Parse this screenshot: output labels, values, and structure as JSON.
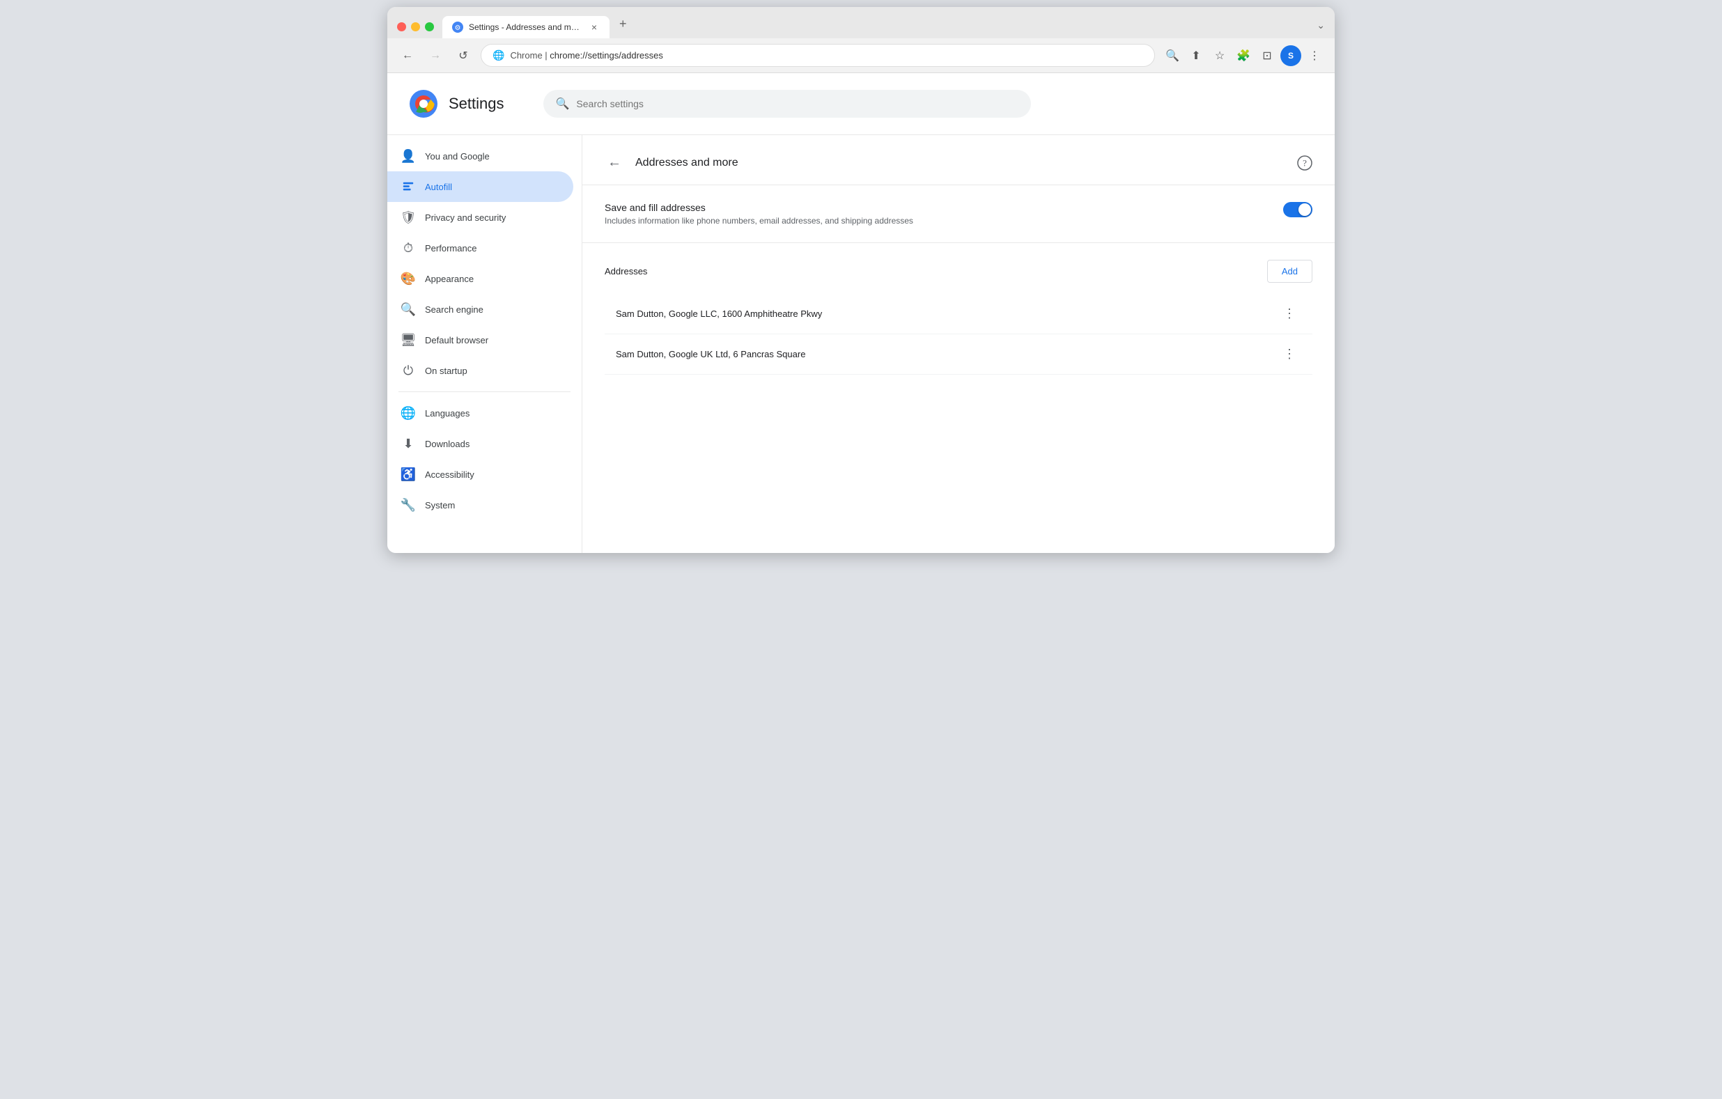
{
  "browser": {
    "tab_title": "Settings - Addresses and more",
    "tab_close": "×",
    "new_tab": "+",
    "dropdown": "⌄",
    "nav": {
      "back": "←",
      "forward": "→",
      "refresh": "↺",
      "favicon_label": "chrome-icon",
      "domain": "Chrome  |  ",
      "address": "chrome://settings/addresses"
    },
    "toolbar_icons": [
      "search",
      "share",
      "star",
      "puzzle",
      "split",
      "profile",
      "menu"
    ]
  },
  "settings_page": {
    "logo_alt": "Google Chrome logo",
    "title": "Settings",
    "search_placeholder": "Search settings"
  },
  "sidebar": {
    "items": [
      {
        "id": "you-and-google",
        "label": "You and Google",
        "icon": "person"
      },
      {
        "id": "autofill",
        "label": "Autofill",
        "icon": "autofill",
        "active": true
      },
      {
        "id": "privacy-security",
        "label": "Privacy and security",
        "icon": "shield"
      },
      {
        "id": "performance",
        "label": "Performance",
        "icon": "performance"
      },
      {
        "id": "appearance",
        "label": "Appearance",
        "icon": "palette"
      },
      {
        "id": "search-engine",
        "label": "Search engine",
        "icon": "search"
      },
      {
        "id": "default-browser",
        "label": "Default browser",
        "icon": "browser"
      },
      {
        "id": "on-startup",
        "label": "On startup",
        "icon": "power"
      },
      {
        "id": "languages",
        "label": "Languages",
        "icon": "globe"
      },
      {
        "id": "downloads",
        "label": "Downloads",
        "icon": "download"
      },
      {
        "id": "accessibility",
        "label": "Accessibility",
        "icon": "accessibility"
      },
      {
        "id": "system",
        "label": "System",
        "icon": "wrench"
      }
    ]
  },
  "content": {
    "back_label": "←",
    "title": "Addresses and more",
    "help_icon": "?",
    "save_fill_setting": {
      "name": "Save and fill addresses",
      "description": "Includes information like phone numbers, email addresses, and shipping addresses",
      "enabled": true
    },
    "addresses_section": {
      "label": "Addresses",
      "add_button": "Add",
      "items": [
        {
          "text": "Sam Dutton, Google LLC, 1600 Amphitheatre Pkwy"
        },
        {
          "text": "Sam Dutton, Google UK Ltd, 6 Pancras Square"
        }
      ]
    }
  }
}
